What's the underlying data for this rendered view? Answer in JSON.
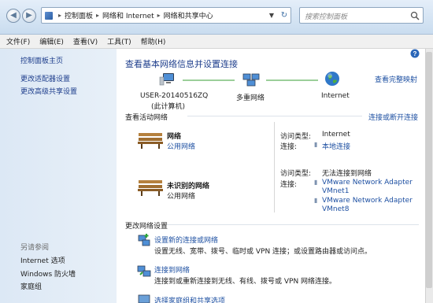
{
  "address": {
    "crumbs": [
      "控制面板",
      "网络和 Internet",
      "网络和共享中心"
    ],
    "separator": "▸"
  },
  "search": {
    "placeholder": "搜索控制面板"
  },
  "menu": [
    "文件(F)",
    "编辑(E)",
    "查看(V)",
    "工具(T)",
    "帮助(H)"
  ],
  "left": {
    "home": "控制面板主页",
    "links": [
      "更改适配器设置",
      "更改高级共享设置"
    ],
    "see_also_title": "另请参阅",
    "see_also": [
      "Internet 选项",
      "Windows 防火墙",
      "家庭组"
    ]
  },
  "main": {
    "title": "查看基本网络信息并设置连接",
    "map_link": "查看完整映射",
    "map": {
      "computer_name": "USER-20140516ZQ",
      "computer_sub": "(此计算机)",
      "middle": "多重网络",
      "internet": "Internet"
    },
    "active_title": "查看活动网络",
    "connect_link": "连接或断开连接",
    "networks": [
      {
        "name": "网络",
        "type": "公用网络",
        "access_label": "访问类型:",
        "access_value": "Internet",
        "conn_label": "连接:",
        "conn_values": [
          "本地连接"
        ]
      },
      {
        "name": "未识别的网络",
        "type": "公用网络",
        "access_label": "访问类型:",
        "access_value": "无法连接到网络",
        "conn_label": "连接:",
        "conn_values": [
          "VMware Network Adapter",
          "VMnet1",
          "VMware Network Adapter",
          "VMnet8"
        ]
      }
    ],
    "change_title": "更改网络设置",
    "tasks": [
      {
        "link": "设置新的连接或网络",
        "desc": "设置无线、宽带、拨号、临时或 VPN 连接；或设置路由器或访问点。"
      },
      {
        "link": "连接到网络",
        "desc": "连接到或重新连接到无线、有线、拨号或 VPN 网络连接。"
      },
      {
        "link": "选择家庭组和共享选项",
        "desc": ""
      }
    ]
  },
  "colors": {
    "link": "#1e50a2",
    "title": "#1e3e8c",
    "bg_left": "#dce8f5"
  }
}
